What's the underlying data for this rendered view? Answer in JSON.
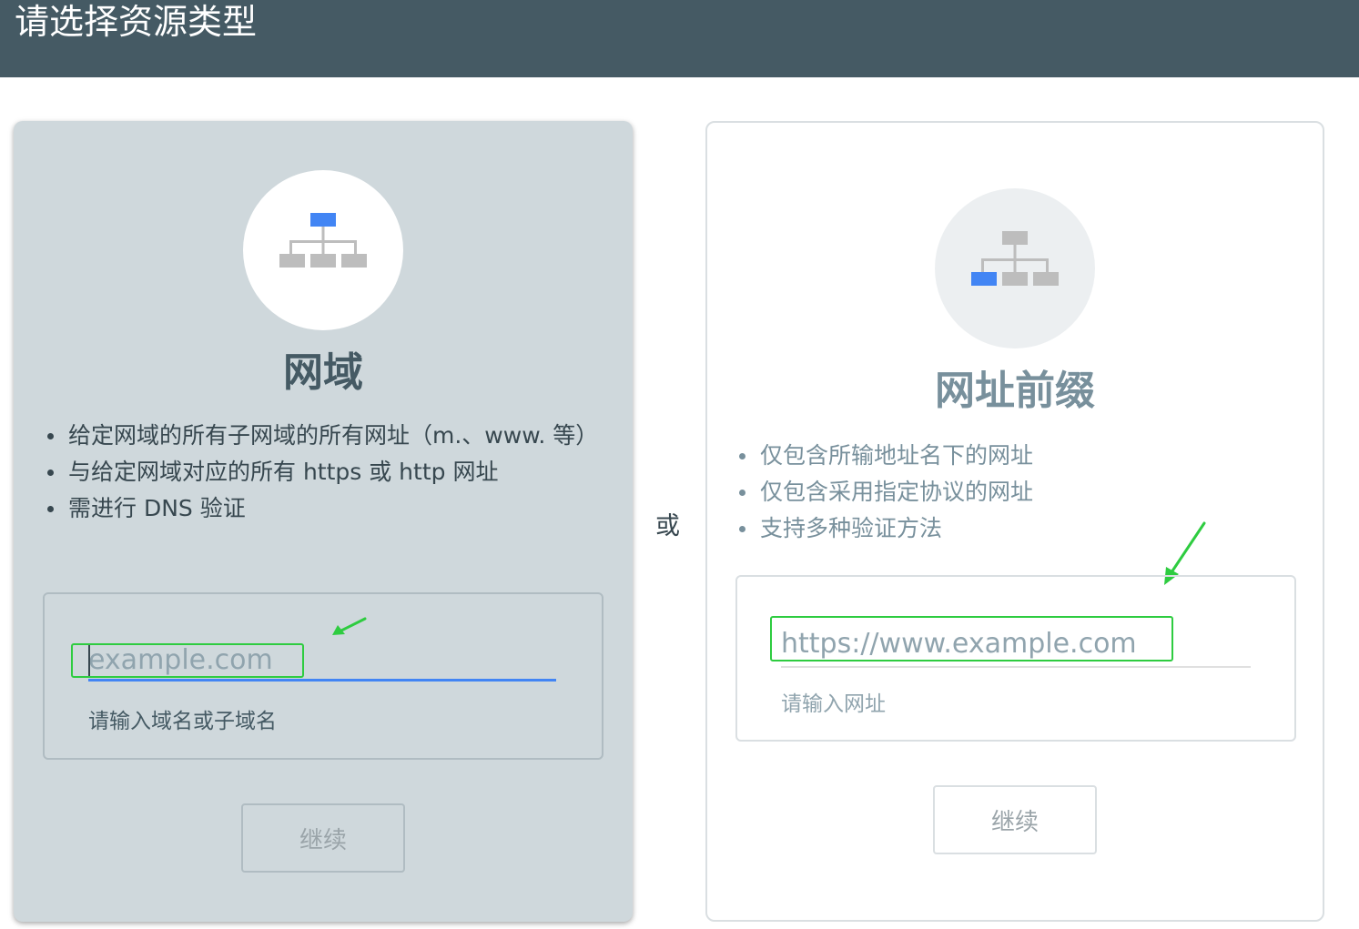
{
  "header": {
    "title": "请选择资源类型"
  },
  "separator": "或",
  "domain_card": {
    "title": "网域",
    "icon": "sitemap-icon",
    "features": [
      "给定网域的所有子网域的所有网址（m.、www. 等）",
      "与给定网域对应的所有 https 或 http 网址",
      "需进行 DNS 验证"
    ],
    "input_value": "",
    "input_placeholder": "example.com",
    "hint": "请输入域名或子域名",
    "continue_label": "继续"
  },
  "prefix_card": {
    "title": "网址前缀",
    "icon": "sitemap-icon",
    "features": [
      "仅包含所输地址名下的网址",
      "仅包含采用指定协议的网址",
      "支持多种验证方法"
    ],
    "input_value": "",
    "input_placeholder": "https://www.example.com",
    "hint": "请输入网址",
    "continue_label": "继续"
  },
  "colors": {
    "header_bg": "#455a64",
    "selected_card_bg": "#cfd8dc",
    "accent_blue": "#4285f4",
    "annotation_green": "#2ecc40",
    "node_gray": "#bdbdbd"
  }
}
